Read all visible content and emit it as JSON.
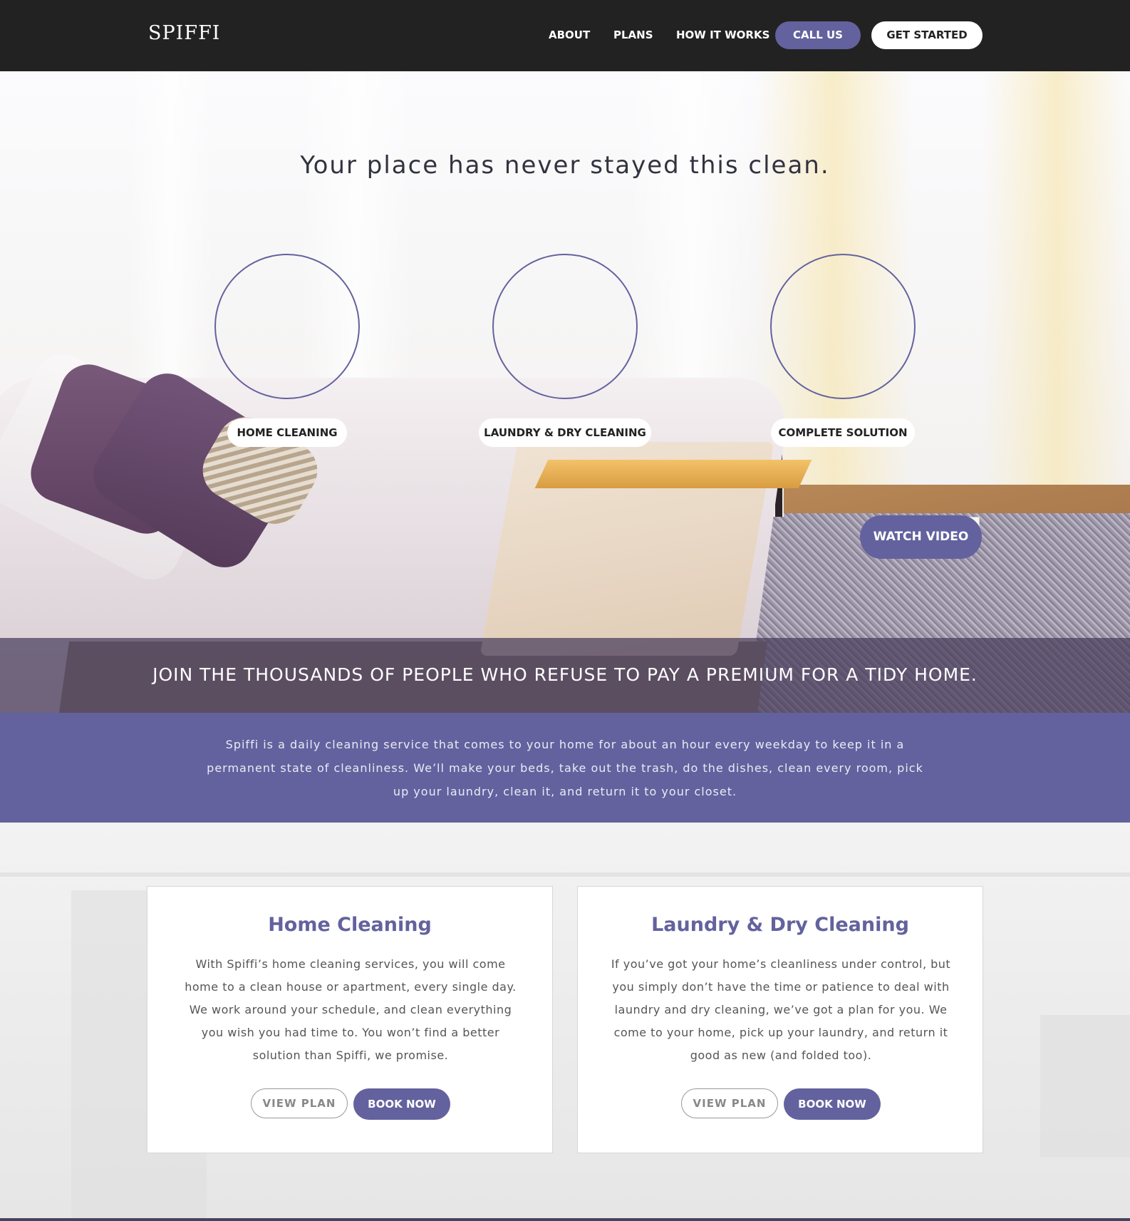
{
  "header": {
    "logo": "SPIFFI",
    "nav": [
      "ABOUT",
      "PLANS",
      "HOW IT WORKS"
    ],
    "call_label": "CALL US",
    "start_label": "GET STARTED"
  },
  "hero": {
    "title": "Your place has never stayed this clean.",
    "services": [
      "HOME CLEANING",
      "LAUNDRY & DRY CLEANING",
      "COMPLETE SOLUTION"
    ],
    "watch_label": "WATCH VIDEO",
    "banner": "JOIN THE THOUSANDS OF PEOPLE WHO REFUSE TO PAY A PREMIUM FOR A TIDY HOME."
  },
  "intro": {
    "text": "Spiffi is a daily cleaning service that comes to your home for about an hour every weekday to keep it in a permanent state of cleanliness. We’ll make your beds, take out the trash, do the dishes, clean every room, pick up your laundry, clean it, and return it to your closet."
  },
  "cards": [
    {
      "title": "Home Cleaning",
      "body": "With Spiffi’s home cleaning services, you will come home to a clean house or apartment, every single day. We work around your schedule, and clean everything you wish you had time to. You won’t find a better solution than Spiffi, we promise.",
      "view_label": "VIEW PLAN",
      "book_label": "BOOK NOW"
    },
    {
      "title": "Laundry & Dry Cleaning",
      "body": "If you’ve got your home’s cleanliness under control, but you simply don’t have the time or patience to deal with laundry and dry cleaning, we’ve got a plan for you. We come to your home, pick up your laundry, and return it good as new (and folded too).",
      "view_label": "VIEW PLAN",
      "book_label": "BOOK NOW"
    }
  ],
  "colors": {
    "accent": "#63629e",
    "header_bg": "#222222"
  }
}
